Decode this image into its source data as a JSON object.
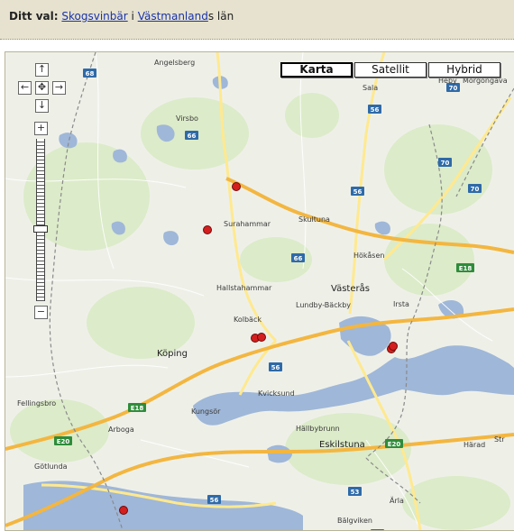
{
  "selection": {
    "label": "Ditt val:",
    "species": "Skogsvinbär",
    "connector": "i",
    "county_link": "Västmanland",
    "county_suffix": "s län"
  },
  "map": {
    "type_buttons": [
      {
        "label": "Karta",
        "active": true
      },
      {
        "label": "Satellit",
        "active": false
      },
      {
        "label": "Hybrid",
        "active": false
      }
    ],
    "zoom_in": "+",
    "zoom_out": "−",
    "places": {
      "angelsberg": "Angelsberg",
      "virsbo": "Virsbo",
      "sala": "Sala",
      "heby": "Heby",
      "morgongava": "Morgongåva",
      "surahammar": "Surahammar",
      "skultuna": "Skultuna",
      "hokasen": "Hökåsen",
      "hallstahammar": "Hallstahammar",
      "vasteras": "Västerås",
      "lundby": "Lundby-Bäckby",
      "irsta": "Irsta",
      "kolback": "Kolbäck",
      "koping": "Köping",
      "fellingsbro": "Fellingsbro",
      "kvicksund": "Kvicksund",
      "kungsor": "Kungsör",
      "arboga": "Arboga",
      "hallbybrunn": "Hällbybrunn",
      "eskilstuna": "Eskilstuna",
      "harad": "Härad",
      "str": "Str",
      "gotlunda": "Götlunda",
      "arla": "Ärla",
      "balgviken": "Bälgviken"
    },
    "road_shields": [
      "68",
      "70",
      "66",
      "56",
      "70",
      "56",
      "70",
      "66",
      "E18",
      "56",
      "E18",
      "E20",
      "E20",
      "56",
      "53",
      "56"
    ],
    "colors": {
      "land": "#eef0e8",
      "forest": "#dcebc9",
      "water": "#9fb7d8",
      "highway": "#f3b640",
      "road": "#ffe98f",
      "marker": "#d41f1f",
      "border": "#8a8a8a"
    },
    "marker_count": 7
  }
}
